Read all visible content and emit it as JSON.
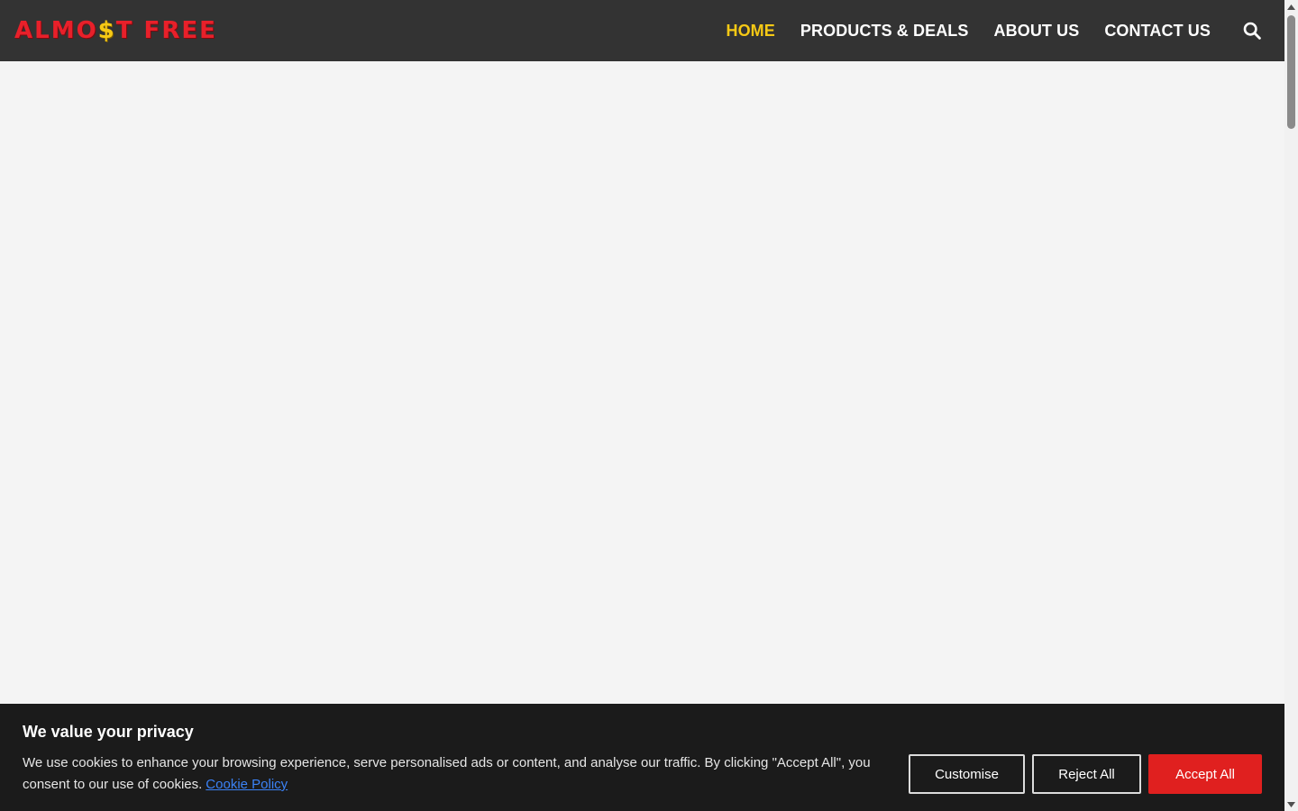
{
  "header": {
    "logo": {
      "part1": "ALMO",
      "part2": "$",
      "part3": "T FREE"
    },
    "nav": {
      "home": "HOME",
      "products": "PRODUCTS & DEALS",
      "about": "ABOUT US",
      "contact": "CONTACT US"
    },
    "active_color": "#f6c915",
    "bar_color": "#333333"
  },
  "cookie_banner": {
    "title": "We value your privacy",
    "text": "We use cookies to enhance your browsing experience, serve personalised ads or content, and analyse our traffic. By clicking \"Accept All\", you consent to our use of cookies.",
    "link": "Cookie Policy",
    "buttons": {
      "customise": "Customise",
      "reject": "Reject All",
      "accept": "Accept All"
    },
    "accept_color": "#e0201f"
  },
  "icons": {
    "search": "search-icon"
  }
}
